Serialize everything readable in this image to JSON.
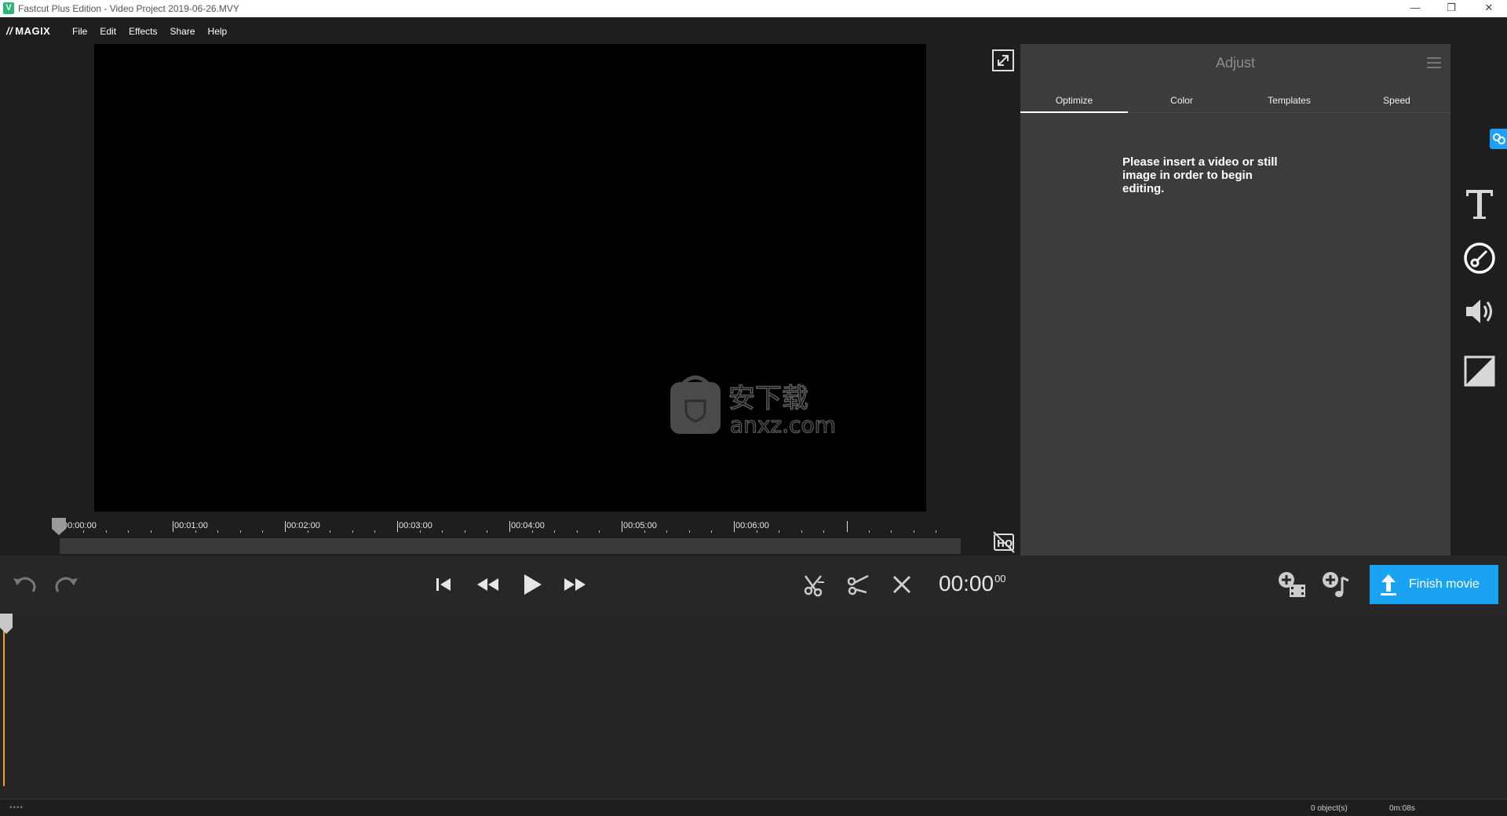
{
  "window": {
    "title": "Fastcut Plus Edition - Video Project 2019-06-26.MVY",
    "app_icon_letter": "V",
    "minimize": "—",
    "restore": "❐",
    "close": "✕"
  },
  "menubar": {
    "logo": "MAGIX",
    "logo_slashes": "//",
    "items": [
      "File",
      "Edit",
      "Effects",
      "Share",
      "Help"
    ]
  },
  "watermark": {
    "text_cn": "安下载",
    "text_en": "anxz.com"
  },
  "ruler": {
    "labels": [
      "00:00:00",
      "00:01:00",
      "00:02:00",
      "00:03:00",
      "00:04:00",
      "00:05:00",
      "00:06:00"
    ]
  },
  "adjust_panel": {
    "title": "Adjust",
    "tabs": [
      "Optimize",
      "Color",
      "Templates",
      "Speed"
    ],
    "active_tab": "Optimize",
    "message": "Please insert a video or still image in order to begin editing."
  },
  "sidebar": {
    "icons": [
      "text-icon",
      "adjust-icon",
      "audio-icon",
      "transition-icon"
    ],
    "selected": "adjust-icon"
  },
  "transport": {
    "timecode_main": "00:00",
    "timecode_frames": "00",
    "finish_label": "Finish movie"
  },
  "status": {
    "dots": "••••",
    "objects": "0 object(s)",
    "duration": "0m:08s"
  },
  "colors": {
    "accent": "#1aa3f3",
    "playhead": "#f0a020",
    "panel_bg": "#3c3c3c",
    "app_bg": "#1e1e1e"
  }
}
